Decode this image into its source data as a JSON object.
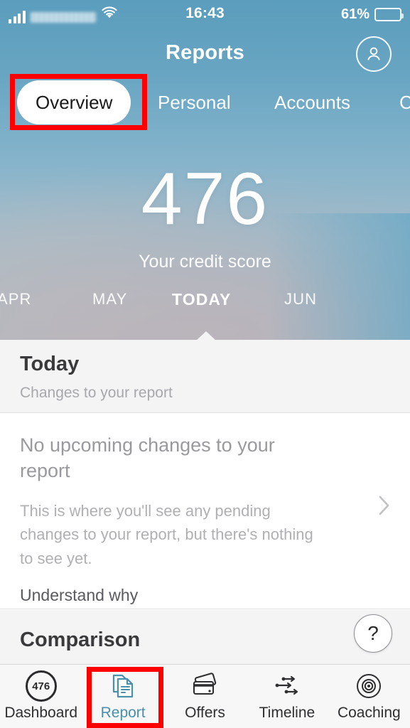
{
  "statusbar": {
    "carrier_blurred": "",
    "time": "16:43",
    "battery_percent": "61%",
    "battery_level": 61,
    "signal_icon": "signal-bars-icon",
    "wifi_icon": "wifi-icon",
    "battery_icon": "battery-icon"
  },
  "header": {
    "title": "Reports",
    "avatar_icon": "user-avatar-icon",
    "tabs": [
      {
        "label": "Overview",
        "active": true
      },
      {
        "label": "Personal",
        "active": false
      },
      {
        "label": "Accounts",
        "active": false
      },
      {
        "label": "C",
        "active": false
      }
    ]
  },
  "score": {
    "value": "476",
    "label": "Your credit score"
  },
  "timeline": {
    "months": [
      {
        "label": "APR",
        "current": false
      },
      {
        "label": "MAY",
        "current": false
      },
      {
        "label": "TODAY",
        "current": true
      },
      {
        "label": "JUN",
        "current": false
      }
    ]
  },
  "today_section": {
    "title": "Today",
    "subtitle": "Changes to your report"
  },
  "card": {
    "title": "No upcoming changes to your report",
    "body": "This is where you'll see any pending changes to your report, but there's nothing to see yet.",
    "link": "Understand why",
    "chevron_icon": "chevron-right-icon"
  },
  "comparison_section": {
    "title": "Comparison"
  },
  "help": {
    "label": "?",
    "icon": "help-question-icon"
  },
  "tabbar": {
    "items": [
      {
        "label": "Dashboard",
        "icon": "score-ring-icon",
        "badge": "476",
        "active": false
      },
      {
        "label": "Report",
        "icon": "document-icon",
        "active": true
      },
      {
        "label": "Offers",
        "icon": "credit-cards-icon",
        "active": false
      },
      {
        "label": "Timeline",
        "icon": "timeline-sliders-icon",
        "active": false
      },
      {
        "label": "Coaching",
        "icon": "target-icon",
        "active": false
      }
    ]
  },
  "colors": {
    "hero_top": "#5b9dbd",
    "hero_bottom": "#b9bbc0",
    "active_tab_accent": "#4a90a8",
    "annotation": "#ff0000",
    "section_bg": "#f4f4f5"
  }
}
